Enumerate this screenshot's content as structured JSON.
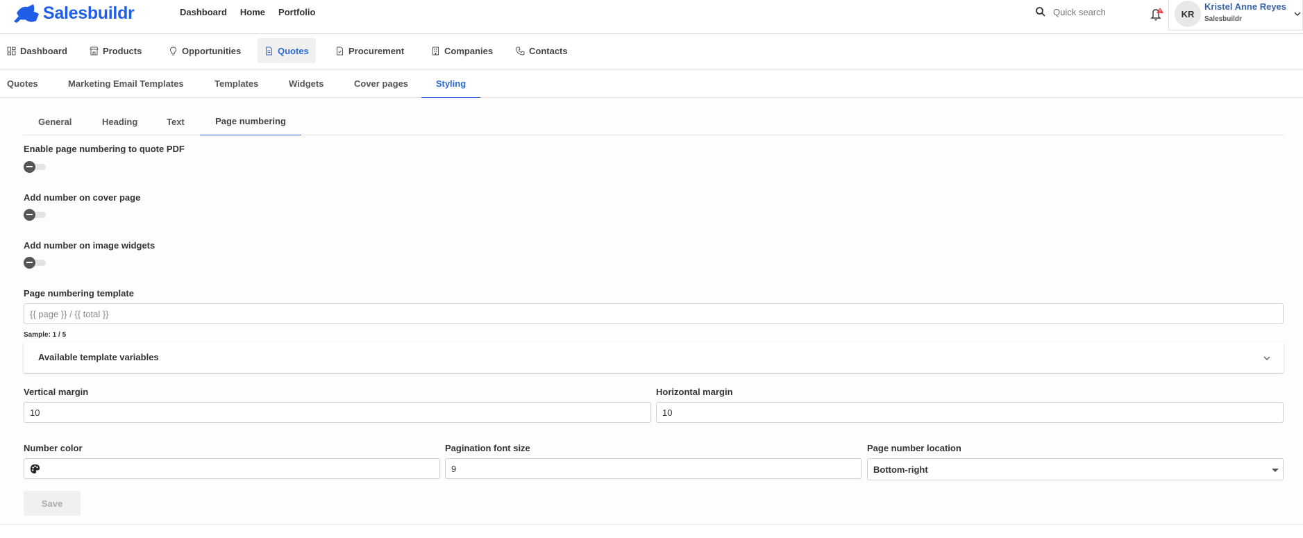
{
  "brand": {
    "name": "Salesbuildr",
    "color": "#1f5ee6"
  },
  "topnav": [
    "Dashboard",
    "Home",
    "Portfolio"
  ],
  "search": {
    "placeholder": "Quick search"
  },
  "user": {
    "initials": "KR",
    "name": "Kristel Anne Reyes",
    "company": "Salesbuildr"
  },
  "mainnav": {
    "active": "Quotes",
    "items": [
      {
        "label": "Dashboard",
        "icon": "dashboard-grid-icon"
      },
      {
        "label": "Products",
        "icon": "store-icon"
      },
      {
        "label": "Opportunities",
        "icon": "lightbulb-icon"
      },
      {
        "label": "Quotes",
        "icon": "document-icon"
      },
      {
        "label": "Procurement",
        "icon": "file-check-icon"
      },
      {
        "label": "Companies",
        "icon": "building-icon"
      },
      {
        "label": "Contacts",
        "icon": "phone-icon"
      }
    ]
  },
  "subnav": {
    "active": "Styling",
    "items": [
      "Quotes",
      "Marketing Email Templates",
      "Templates",
      "Widgets",
      "Cover pages",
      "Styling"
    ]
  },
  "innertabs": {
    "active": "Page numbering",
    "items": [
      "General",
      "Heading",
      "Text",
      "Page numbering"
    ]
  },
  "form": {
    "enable_numbering": {
      "label": "Enable page numbering to quote PDF",
      "enabled": false
    },
    "cover_page": {
      "label": "Add number on cover page",
      "enabled": false
    },
    "image_widgets": {
      "label": "Add number on image widgets",
      "enabled": false
    },
    "template": {
      "label": "Page numbering template",
      "placeholder": "{{ page }} / {{ total }}"
    },
    "sample": "Sample: 1 / 5",
    "variables": {
      "label": "Available template variables"
    },
    "vertical_margin": {
      "label": "Vertical margin",
      "value": "10"
    },
    "horizontal_margin": {
      "label": "Horizontal margin",
      "value": "10"
    },
    "number_color": {
      "label": "Number color",
      "icon": "palette-icon"
    },
    "font_size": {
      "label": "Pagination font size",
      "value": "9"
    },
    "location": {
      "label": "Page number location",
      "value": "Bottom-right"
    },
    "save_label": "Save"
  },
  "colors": {
    "accent": "#2a6bd8",
    "notification": "#e53935"
  }
}
